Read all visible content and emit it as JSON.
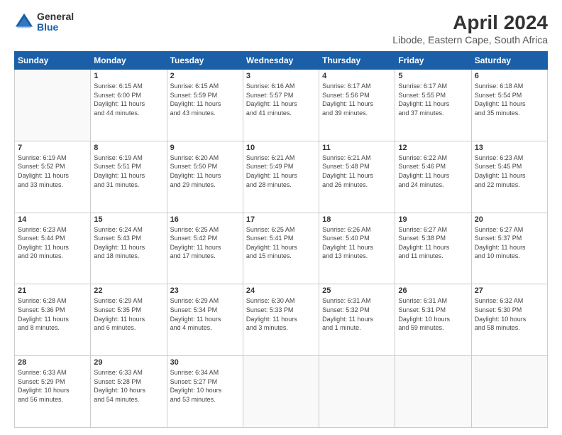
{
  "header": {
    "logo": {
      "general": "General",
      "blue": "Blue"
    },
    "title": "April 2024",
    "subtitle": "Libode, Eastern Cape, South Africa"
  },
  "calendar": {
    "days_of_week": [
      "Sunday",
      "Monday",
      "Tuesday",
      "Wednesday",
      "Thursday",
      "Friday",
      "Saturday"
    ],
    "weeks": [
      [
        {
          "day": "",
          "info": ""
        },
        {
          "day": "1",
          "info": "Sunrise: 6:15 AM\nSunset: 6:00 PM\nDaylight: 11 hours\nand 44 minutes."
        },
        {
          "day": "2",
          "info": "Sunrise: 6:15 AM\nSunset: 5:59 PM\nDaylight: 11 hours\nand 43 minutes."
        },
        {
          "day": "3",
          "info": "Sunrise: 6:16 AM\nSunset: 5:57 PM\nDaylight: 11 hours\nand 41 minutes."
        },
        {
          "day": "4",
          "info": "Sunrise: 6:17 AM\nSunset: 5:56 PM\nDaylight: 11 hours\nand 39 minutes."
        },
        {
          "day": "5",
          "info": "Sunrise: 6:17 AM\nSunset: 5:55 PM\nDaylight: 11 hours\nand 37 minutes."
        },
        {
          "day": "6",
          "info": "Sunrise: 6:18 AM\nSunset: 5:54 PM\nDaylight: 11 hours\nand 35 minutes."
        }
      ],
      [
        {
          "day": "7",
          "info": "Sunrise: 6:19 AM\nSunset: 5:52 PM\nDaylight: 11 hours\nand 33 minutes."
        },
        {
          "day": "8",
          "info": "Sunrise: 6:19 AM\nSunset: 5:51 PM\nDaylight: 11 hours\nand 31 minutes."
        },
        {
          "day": "9",
          "info": "Sunrise: 6:20 AM\nSunset: 5:50 PM\nDaylight: 11 hours\nand 29 minutes."
        },
        {
          "day": "10",
          "info": "Sunrise: 6:21 AM\nSunset: 5:49 PM\nDaylight: 11 hours\nand 28 minutes."
        },
        {
          "day": "11",
          "info": "Sunrise: 6:21 AM\nSunset: 5:48 PM\nDaylight: 11 hours\nand 26 minutes."
        },
        {
          "day": "12",
          "info": "Sunrise: 6:22 AM\nSunset: 5:46 PM\nDaylight: 11 hours\nand 24 minutes."
        },
        {
          "day": "13",
          "info": "Sunrise: 6:23 AM\nSunset: 5:45 PM\nDaylight: 11 hours\nand 22 minutes."
        }
      ],
      [
        {
          "day": "14",
          "info": "Sunrise: 6:23 AM\nSunset: 5:44 PM\nDaylight: 11 hours\nand 20 minutes."
        },
        {
          "day": "15",
          "info": "Sunrise: 6:24 AM\nSunset: 5:43 PM\nDaylight: 11 hours\nand 18 minutes."
        },
        {
          "day": "16",
          "info": "Sunrise: 6:25 AM\nSunset: 5:42 PM\nDaylight: 11 hours\nand 17 minutes."
        },
        {
          "day": "17",
          "info": "Sunrise: 6:25 AM\nSunset: 5:41 PM\nDaylight: 11 hours\nand 15 minutes."
        },
        {
          "day": "18",
          "info": "Sunrise: 6:26 AM\nSunset: 5:40 PM\nDaylight: 11 hours\nand 13 minutes."
        },
        {
          "day": "19",
          "info": "Sunrise: 6:27 AM\nSunset: 5:38 PM\nDaylight: 11 hours\nand 11 minutes."
        },
        {
          "day": "20",
          "info": "Sunrise: 6:27 AM\nSunset: 5:37 PM\nDaylight: 11 hours\nand 10 minutes."
        }
      ],
      [
        {
          "day": "21",
          "info": "Sunrise: 6:28 AM\nSunset: 5:36 PM\nDaylight: 11 hours\nand 8 minutes."
        },
        {
          "day": "22",
          "info": "Sunrise: 6:29 AM\nSunset: 5:35 PM\nDaylight: 11 hours\nand 6 minutes."
        },
        {
          "day": "23",
          "info": "Sunrise: 6:29 AM\nSunset: 5:34 PM\nDaylight: 11 hours\nand 4 minutes."
        },
        {
          "day": "24",
          "info": "Sunrise: 6:30 AM\nSunset: 5:33 PM\nDaylight: 11 hours\nand 3 minutes."
        },
        {
          "day": "25",
          "info": "Sunrise: 6:31 AM\nSunset: 5:32 PM\nDaylight: 11 hours\nand 1 minute."
        },
        {
          "day": "26",
          "info": "Sunrise: 6:31 AM\nSunset: 5:31 PM\nDaylight: 10 hours\nand 59 minutes."
        },
        {
          "day": "27",
          "info": "Sunrise: 6:32 AM\nSunset: 5:30 PM\nDaylight: 10 hours\nand 58 minutes."
        }
      ],
      [
        {
          "day": "28",
          "info": "Sunrise: 6:33 AM\nSunset: 5:29 PM\nDaylight: 10 hours\nand 56 minutes."
        },
        {
          "day": "29",
          "info": "Sunrise: 6:33 AM\nSunset: 5:28 PM\nDaylight: 10 hours\nand 54 minutes."
        },
        {
          "day": "30",
          "info": "Sunrise: 6:34 AM\nSunset: 5:27 PM\nDaylight: 10 hours\nand 53 minutes."
        },
        {
          "day": "",
          "info": ""
        },
        {
          "day": "",
          "info": ""
        },
        {
          "day": "",
          "info": ""
        },
        {
          "day": "",
          "info": ""
        }
      ]
    ]
  }
}
